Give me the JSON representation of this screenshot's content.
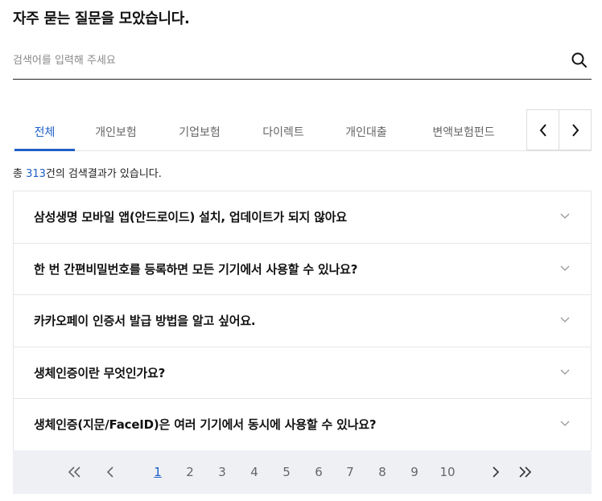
{
  "heading": "자주 묻는 질문을 모았습니다.",
  "search": {
    "placeholder": "검색어를 입력해 주세요",
    "value": ""
  },
  "tabs": [
    {
      "label": "전체",
      "active": true
    },
    {
      "label": "개인보험",
      "active": false
    },
    {
      "label": "기업보험",
      "active": false
    },
    {
      "label": "다이렉트",
      "active": false
    },
    {
      "label": "개인대출",
      "active": false
    },
    {
      "label": "변액보험펀드",
      "active": false
    }
  ],
  "result": {
    "prefix": "총 ",
    "count": "313",
    "suffix": "건의 검색결과가 있습니다."
  },
  "faqs": [
    "삼성생명 모바일 앱(안드로이드) 설치, 업데이트가 되지 않아요",
    "한 번 간편비밀번호를 등록하면 모든 기기에서 사용할 수 있나요?",
    "카카오페이 인증서 발급 방법을 알고 싶어요.",
    "생체인증이란 무엇인가요?",
    "생체인증(지문/FaceID)은 여러 기기에서 동시에 사용할 수 있나요?"
  ],
  "pagination": {
    "pages": [
      "1",
      "2",
      "3",
      "4",
      "5",
      "6",
      "7",
      "8",
      "9",
      "10"
    ],
    "current": "1"
  },
  "colors": {
    "accent": "#1f5fc8",
    "pagination_bg": "#eef0f4"
  }
}
